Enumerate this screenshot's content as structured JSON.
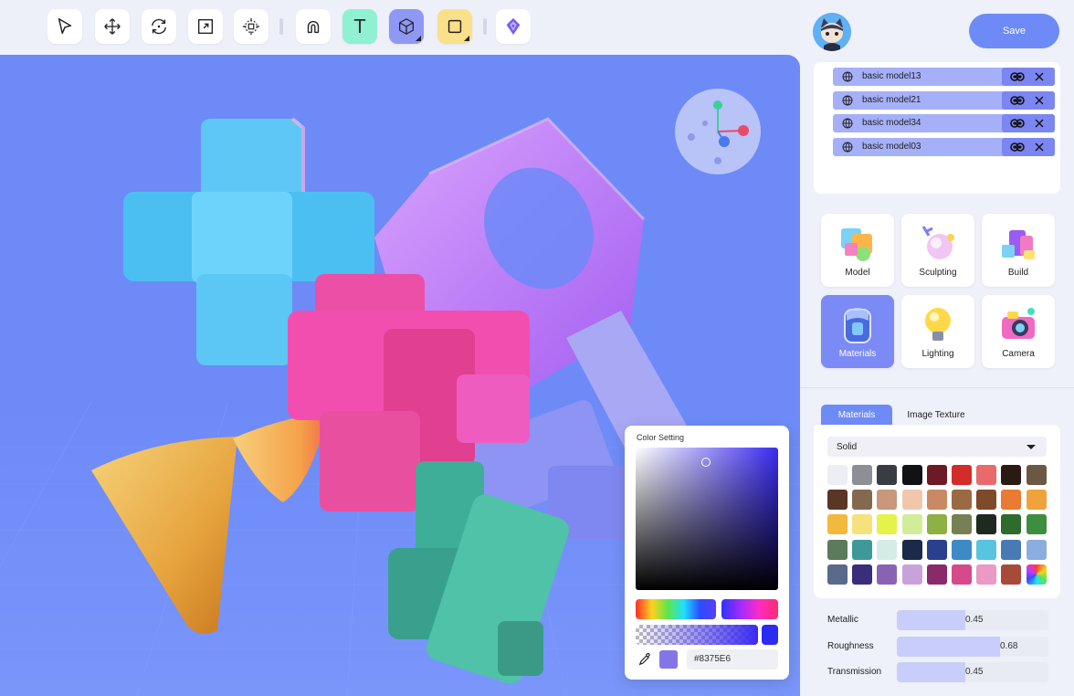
{
  "toolbar": {
    "tools": [
      {
        "name": "select-tool",
        "icon": "cursor-icon"
      },
      {
        "name": "move-tool",
        "icon": "move-arrows-icon"
      },
      {
        "name": "rotate-tool",
        "icon": "rotate-icon"
      },
      {
        "name": "scale-tool",
        "icon": "scale-icon"
      },
      {
        "name": "transform-tool",
        "icon": "transform-gizmo-icon"
      },
      {
        "name": "magnet-tool",
        "icon": "magnet-icon"
      },
      {
        "name": "text-tool",
        "icon": "text-T-icon"
      },
      {
        "name": "cube-tool",
        "icon": "cube-icon"
      },
      {
        "name": "shape-tool",
        "icon": "square-icon"
      },
      {
        "name": "app-logo",
        "icon": "logo-icon"
      }
    ],
    "text_tool_label": "T"
  },
  "header": {
    "save_label": "Save",
    "avatar": "cat-avatar"
  },
  "layers": [
    {
      "name": "basic model13"
    },
    {
      "name": "basic model21"
    },
    {
      "name": "basic model34"
    },
    {
      "name": "basic model03"
    }
  ],
  "modes": [
    {
      "label": "Model",
      "active": false
    },
    {
      "label": "Sculpting",
      "active": false
    },
    {
      "label": "Build",
      "active": false
    },
    {
      "label": "Materials",
      "active": true
    },
    {
      "label": "Lighting",
      "active": false
    },
    {
      "label": "Camera",
      "active": false
    }
  ],
  "materials_panel": {
    "tabs": [
      "Materials",
      "Image Texture"
    ],
    "active_tab": "Materials",
    "type_select": "Solid",
    "swatches": [
      "#eceef3",
      "#8e8f94",
      "#3a3c44",
      "#111216",
      "#6b1a26",
      "#d42b2b",
      "#e86a6a",
      "#2a1a14",
      "#6b5744",
      "#5a3624",
      "#85694f",
      "#c9977a",
      "#f2c6ad",
      "#c98a63",
      "#9b6a44",
      "#7d4a2a",
      "#ea7a34",
      "#f0a23c",
      "#f2b93e",
      "#f5e27c",
      "#e5f24a",
      "#d2ec9a",
      "#8fb042",
      "#778054",
      "#1e2a20",
      "#2f6b2c",
      "#3d8e3e",
      "#5c7a5c",
      "#3e9a9a",
      "#d4ece6",
      "#1a2a48",
      "#2a3f8e",
      "#3e8ac4",
      "#58c4e0",
      "#4a7ab4",
      "#8aaee0",
      "#5a6a8a",
      "#3a2d7a",
      "#8a62b4",
      "#c9a2d9",
      "#8a2a6a",
      "#d44a8a",
      "#ea9ac4",
      "#a84a3a",
      "rainbow"
    ],
    "properties": [
      {
        "label": "Metallic",
        "value": "0.45",
        "fraction": 0.45
      },
      {
        "label": "Roughness",
        "value": "0.68",
        "fraction": 0.68
      },
      {
        "label": "Transmission",
        "value": "0.45",
        "fraction": 0.45
      }
    ]
  },
  "color_setting": {
    "title": "Color Setting",
    "hex": "#8375E6",
    "swatch_color": "#8375E6"
  },
  "colors": {
    "accent": "#6d8af7",
    "viewport": "#6d8af7"
  }
}
